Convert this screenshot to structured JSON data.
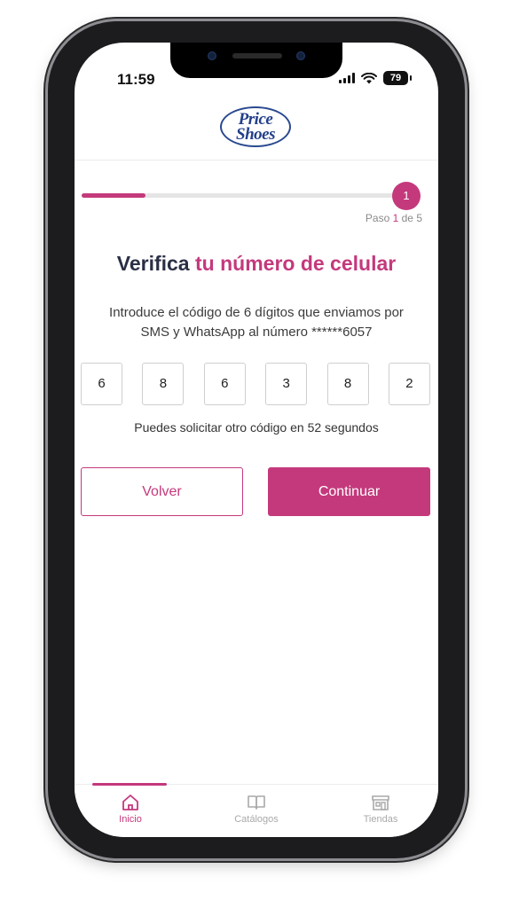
{
  "status_bar": {
    "time": "11:59",
    "battery": "79"
  },
  "header": {
    "logo_line1": "Price",
    "logo_line2": "Shoes"
  },
  "progress": {
    "current_step": "1",
    "step_prefix": "Paso ",
    "step_of": " de 5",
    "fill_fraction": 0.2
  },
  "title": {
    "part1": "Verifica ",
    "part2": "tu número de celular"
  },
  "instructions": {
    "line1": "Introduce el código de 6 dígitos que enviamos por",
    "line2": "SMS y WhatsApp al número  ******6057"
  },
  "code_digits": [
    "6",
    "8",
    "6",
    "3",
    "8",
    "2"
  ],
  "resend_text": "Puedes solicitar otro código en 52 segundos",
  "buttons": {
    "back": "Volver",
    "continue": "Continuar"
  },
  "nav": {
    "items": [
      {
        "label": "Inicio",
        "icon": "home-icon",
        "active": true
      },
      {
        "label": "Catálogos",
        "icon": "book-icon",
        "active": false
      },
      {
        "label": "Tiendas",
        "icon": "store-icon",
        "active": false
      }
    ]
  },
  "colors": {
    "accent": "#c4397c",
    "title": "#2b2f45",
    "logo": "#23408a",
    "inactive": "#a9a9a9"
  }
}
